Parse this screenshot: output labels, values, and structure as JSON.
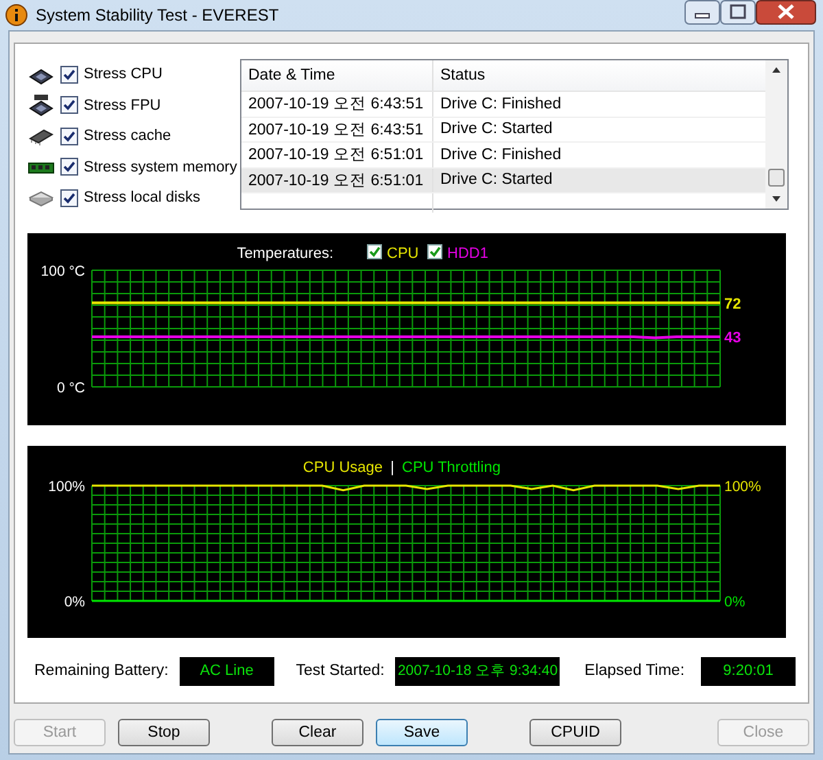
{
  "window": {
    "title": "System Stability Test - EVEREST"
  },
  "stress_options": [
    {
      "label": "Stress CPU",
      "checked": true,
      "kind": "cpu"
    },
    {
      "label": "Stress FPU",
      "checked": true,
      "kind": "fpu"
    },
    {
      "label": "Stress cache",
      "checked": true,
      "kind": "cache"
    },
    {
      "label": "Stress system memory",
      "checked": true,
      "kind": "memory"
    },
    {
      "label": "Stress local disks",
      "checked": true,
      "kind": "disk"
    }
  ],
  "log_table": {
    "columns": [
      "Date & Time",
      "Status"
    ],
    "rows": [
      {
        "date_time": "2007-10-19 오전 6:43:51",
        "status": "Drive C: Finished",
        "selected": false
      },
      {
        "date_time": "2007-10-19 오전 6:43:51",
        "status": "Drive C: Started",
        "selected": false
      },
      {
        "date_time": "2007-10-19 오전 6:51:01",
        "status": "Drive C: Finished",
        "selected": false
      },
      {
        "date_time": "2007-10-19 오전 6:51:01",
        "status": "Drive C: Started",
        "selected": true
      }
    ]
  },
  "temperature_graph": {
    "legend_title": "Temperatures:",
    "legend": [
      {
        "checked": true,
        "reading": "72"
      },
      {
        "checked": true,
        "reading": "43"
      }
    ],
    "chart_data": {
      "type": "line",
      "grid": true,
      "ylim": [
        0,
        100
      ],
      "yticks": [
        {
          "value": 0,
          "label": "0 °C"
        },
        {
          "value": 100,
          "label": "100 °C"
        }
      ],
      "series": [
        {
          "name": "CPU",
          "color": "#e6e600",
          "values": [
            72,
            72,
            72,
            72,
            72,
            72,
            72,
            72,
            72,
            72,
            72,
            72,
            72,
            72,
            72,
            72,
            72,
            72,
            72,
            72,
            72,
            72,
            72,
            72,
            72,
            72,
            72,
            72,
            72,
            72
          ]
        },
        {
          "name": "HDD1",
          "color": "#e600e6",
          "values": [
            43,
            43,
            43,
            43,
            43,
            43,
            43,
            43,
            43,
            43,
            43,
            43,
            43,
            43,
            43,
            43,
            43,
            43,
            43,
            43,
            43,
            43,
            43,
            43,
            43,
            43,
            42,
            43,
            43,
            43
          ]
        }
      ]
    }
  },
  "cpu_graph": {
    "separator": "|",
    "right_ticks": [
      {
        "label": "100%",
        "color": "#e6e600"
      },
      {
        "label": "0%",
        "color": "#00e600"
      }
    ],
    "chart_data": {
      "type": "line",
      "grid": true,
      "ylim": [
        0,
        100
      ],
      "yticks": [
        {
          "value": 0,
          "label": "0%"
        },
        {
          "value": 100,
          "label": "100%"
        }
      ],
      "series": [
        {
          "name": "CPU Usage",
          "color": "#e6e600",
          "values": [
            100,
            100,
            100,
            100,
            100,
            100,
            100,
            100,
            100,
            100,
            100,
            100,
            96,
            100,
            100,
            100,
            97,
            100,
            100,
            100,
            100,
            97,
            100,
            96,
            100,
            100,
            100,
            100,
            97,
            100,
            100
          ]
        },
        {
          "name": "CPU Throttling",
          "color": "#00e600",
          "values": [
            0,
            0,
            0,
            0,
            0,
            0,
            0,
            0,
            0,
            0,
            0,
            0,
            0,
            0,
            0,
            0,
            0,
            0,
            0,
            0,
            0,
            0,
            0,
            0,
            0,
            0,
            0,
            0,
            0,
            0,
            0
          ]
        }
      ]
    }
  },
  "status": [
    {
      "label": "Remaining Battery:",
      "value": "AC Line"
    },
    {
      "label": "Test Started:",
      "value": "2007-10-18 오후 9:34:40"
    },
    {
      "label": "Elapsed Time:",
      "value": "9:20:01"
    }
  ],
  "buttons": [
    {
      "label": "Start",
      "disabled": true,
      "default": false
    },
    {
      "label": "Stop",
      "disabled": false,
      "default": false
    },
    {
      "label": "Clear",
      "disabled": false,
      "default": false
    },
    {
      "label": "Save",
      "disabled": false,
      "default": true
    },
    {
      "label": "CPUID",
      "disabled": false,
      "default": false
    },
    {
      "label": "Close",
      "disabled": true,
      "default": false
    }
  ]
}
